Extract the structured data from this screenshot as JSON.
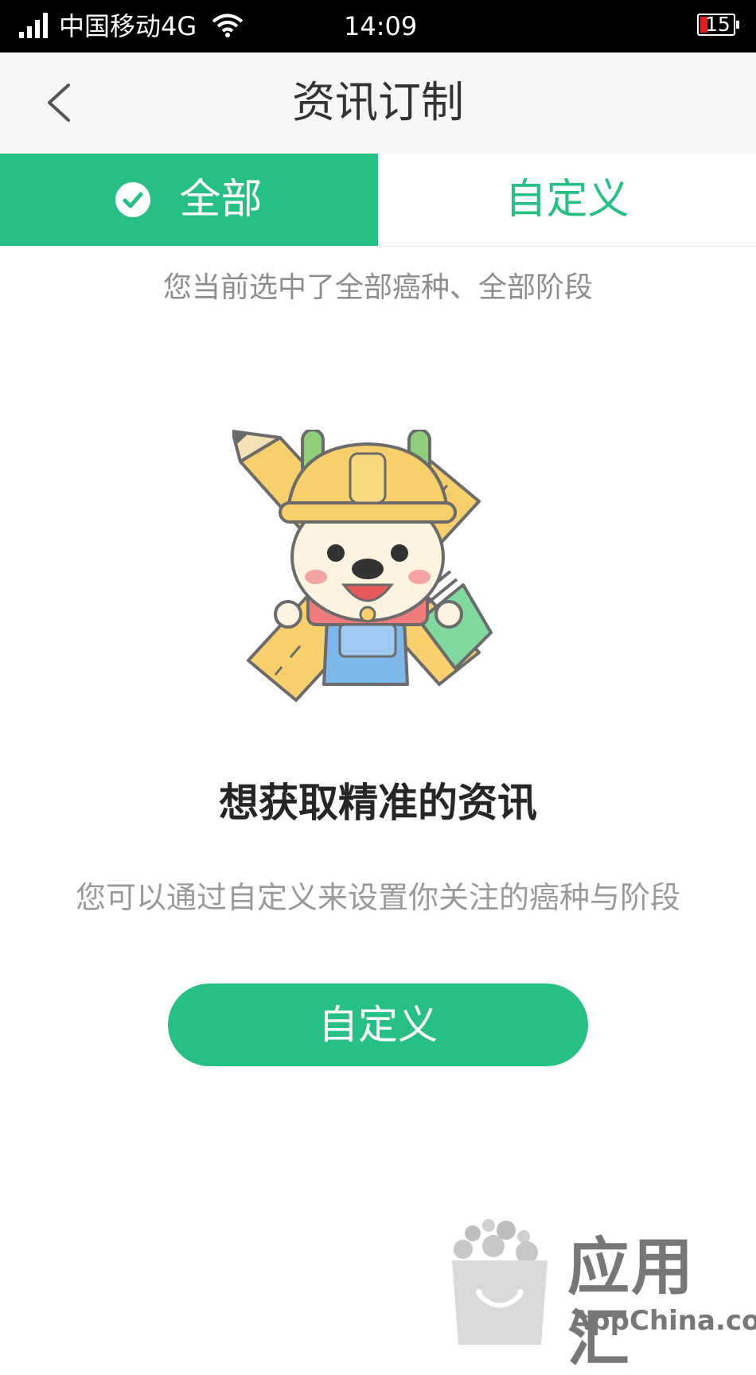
{
  "status_bar": {
    "carrier": "中国移动4G",
    "time": "14:09",
    "battery": "15"
  },
  "nav": {
    "title": "资讯订制",
    "back_icon": "chevron-left-icon"
  },
  "tabs": {
    "all_label": "全部",
    "custom_label": "自定义",
    "active": "all",
    "check_icon": "check-circle-icon"
  },
  "summary": "您当前选中了全部癌种、全部阶段",
  "mascot": "mascot-illustration",
  "headline": "想获取精准的资讯",
  "description": "您可以通过自定义来设置你关注的癌种与阶段",
  "customize_button": "自定义",
  "watermark": {
    "title": "应用汇",
    "subtitle": "AppChina.com"
  },
  "colors": {
    "accent": "#27c084",
    "status_bar": "#000000",
    "nav_background": "#f6f6f6"
  }
}
